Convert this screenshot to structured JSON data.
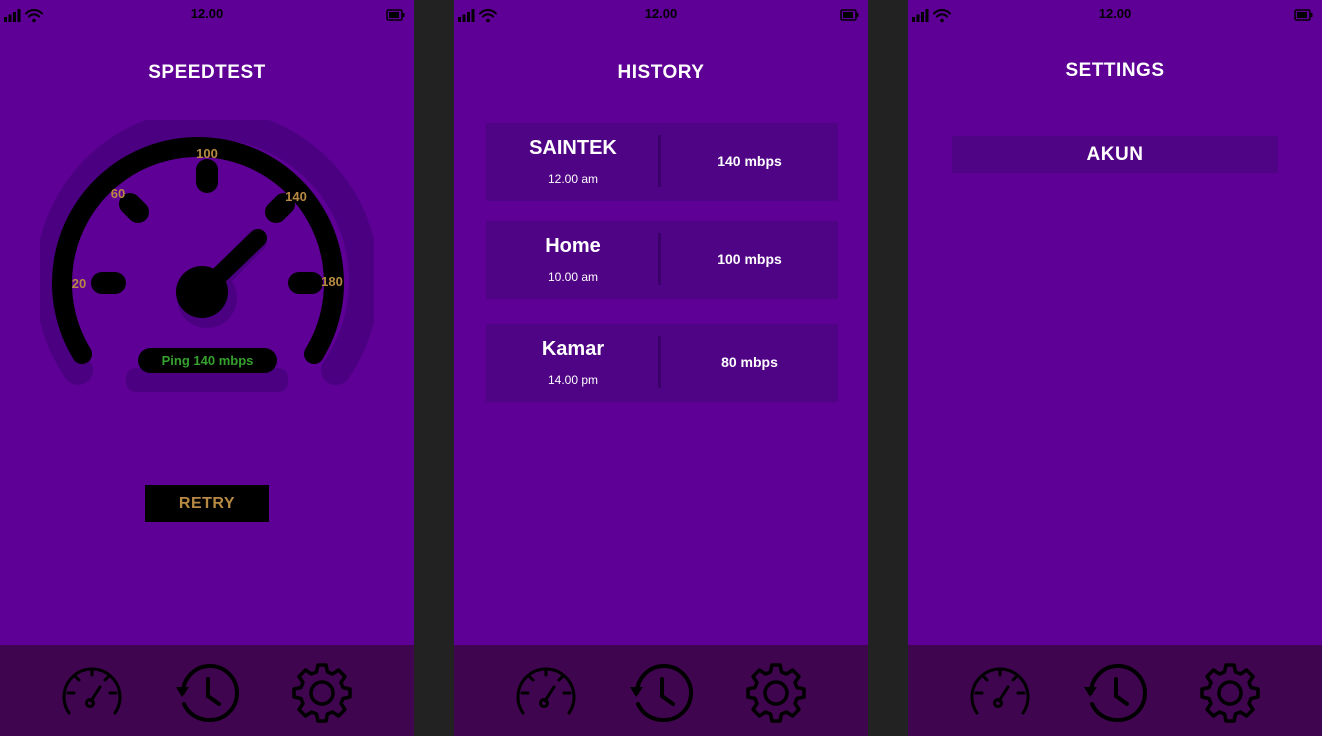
{
  "status_bar": {
    "time": "12.00"
  },
  "speedtest": {
    "title": "SPEEDTEST",
    "gauge_ticks": [
      "20",
      "60",
      "100",
      "140",
      "180"
    ],
    "ping_label": "Ping 140 mbps",
    "retry_label": "RETRY"
  },
  "history": {
    "title": "HISTORY",
    "items": [
      {
        "name": "SAINTEK",
        "time": "12.00 am",
        "speed": "140 mbps"
      },
      {
        "name": "Home",
        "time": "10.00 am",
        "speed": "100 mbps"
      },
      {
        "name": "Kamar",
        "time": "14.00 pm",
        "speed": "80 mbps"
      }
    ]
  },
  "settings": {
    "title": "SETTINGS",
    "akun_label": "AKUN"
  },
  "nav": {
    "icons": [
      "speedometer-icon",
      "history-icon",
      "settings-gear-icon"
    ]
  },
  "colors": {
    "background": "#5e0095",
    "navbar": "#40054f",
    "card": "#4f0385",
    "tick_label": "#b78a43",
    "ping_text": "#36a12f"
  }
}
